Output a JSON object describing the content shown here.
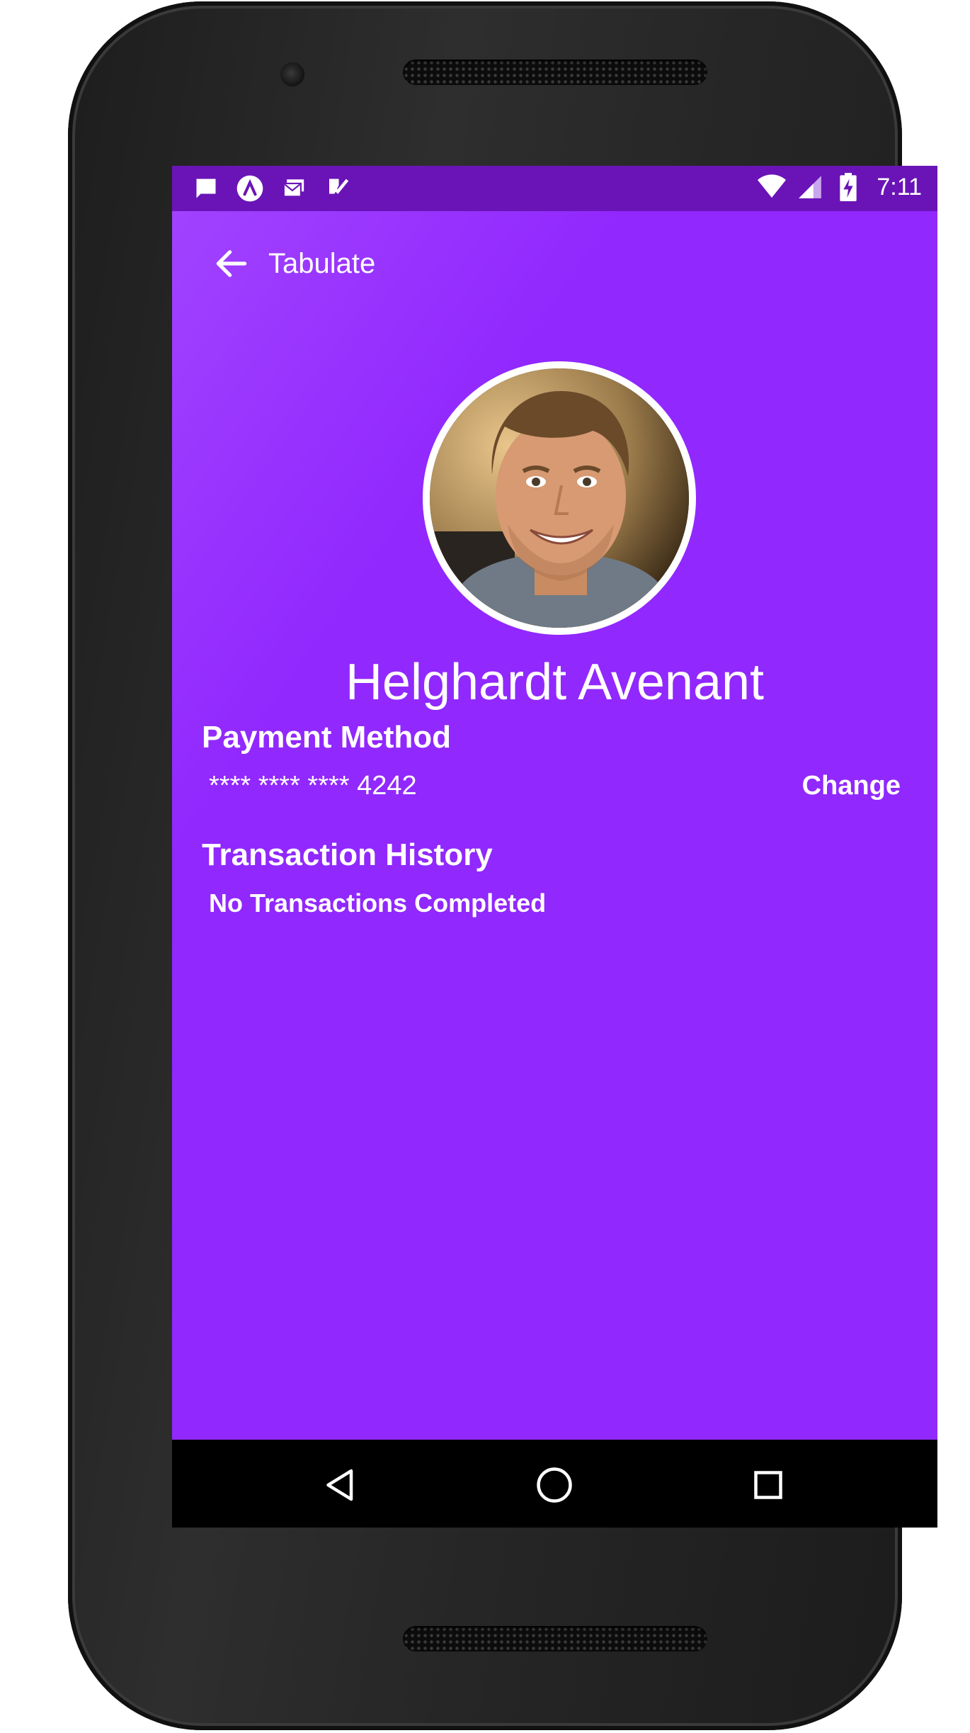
{
  "status_bar": {
    "time": "7:11",
    "left_icons": [
      "message-icon",
      "app-launcher-icon",
      "mail-icon",
      "tasks-check-icon"
    ],
    "right_icons": [
      "wifi-icon",
      "cell-signal-icon",
      "battery-charging-icon"
    ]
  },
  "toolbar": {
    "title": "Tabulate",
    "back_icon": "arrow-left-icon"
  },
  "profile": {
    "name": "Helghardt Avenant",
    "avatar": "user-avatar-photo"
  },
  "payment": {
    "section_title": "Payment Method",
    "card_number": "**** **** **** 4242",
    "change_label": "Change"
  },
  "transactions": {
    "section_title": "Transaction History",
    "empty_text": "No Transactions Completed"
  },
  "navigation": {
    "buttons": [
      "back-triangle-icon",
      "home-circle-icon",
      "recents-square-icon"
    ]
  },
  "colors": {
    "primary": "#9128fe",
    "status_bar": "#6a14b7",
    "text": "#ffffff"
  }
}
